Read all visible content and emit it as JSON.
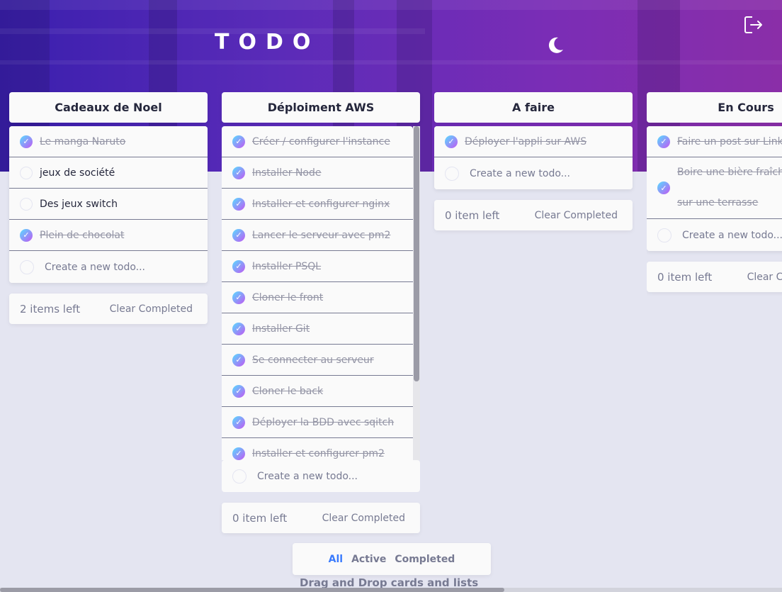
{
  "header": {
    "title": "TODO"
  },
  "lists": [
    {
      "title": "Cadeaux de Noel",
      "todos": [
        {
          "text": "Le manga Naruto",
          "done": true
        },
        {
          "text": "jeux de société",
          "done": false
        },
        {
          "text": "Des jeux switch",
          "done": false
        },
        {
          "text": "Plein de chocolat",
          "done": true
        }
      ],
      "placeholder": "Create a new todo...",
      "items_left": "2 items left",
      "clear_label": "Clear Completed"
    },
    {
      "title": "Déploiment AWS",
      "todos": [
        {
          "text": "Créer / configurer l'instance",
          "done": true
        },
        {
          "text": "Installer Node",
          "done": true
        },
        {
          "text": "Installer et configurer nginx",
          "done": true
        },
        {
          "text": "Lancer le serveur avec pm2",
          "done": true
        },
        {
          "text": "Installer PSQL",
          "done": true
        },
        {
          "text": "Cloner le front",
          "done": true
        },
        {
          "text": "Installer Git",
          "done": true
        },
        {
          "text": "Se connecter au serveur",
          "done": true
        },
        {
          "text": "Cloner le back",
          "done": true
        },
        {
          "text": "Déployer la BDD avec sqitch",
          "done": true
        },
        {
          "text": "Installer et configurer pm2",
          "done": true
        }
      ],
      "placeholder": "Create a new todo...",
      "items_left": "0 item left",
      "clear_label": "Clear Completed"
    },
    {
      "title": "A faire",
      "todos": [
        {
          "text": "Déployer l'appli sur AWS",
          "done": true
        }
      ],
      "placeholder": "Create a new todo...",
      "items_left": "0 item left",
      "clear_label": "Clear Completed"
    },
    {
      "title": "En Cours",
      "todos": [
        {
          "text": "Faire un post sur LinkedIn",
          "done": true
        },
        {
          "text": "Boire une bière fraîche sur une terrasse",
          "done": true
        }
      ],
      "placeholder": "Create a new todo...",
      "items_left": "0 item left",
      "clear_label": "Clear Completed"
    }
  ],
  "filters": {
    "all": "All",
    "active": "Active",
    "completed": "Completed",
    "selected": "All"
  },
  "hint": "Drag and Drop cards and lists",
  "colors": {
    "accent": "#3a7bfd",
    "check_gradient_start": "#57ddff",
    "check_gradient_end": "#c058f3"
  },
  "icons": {
    "theme": "moon-icon",
    "logout": "logout-icon"
  }
}
